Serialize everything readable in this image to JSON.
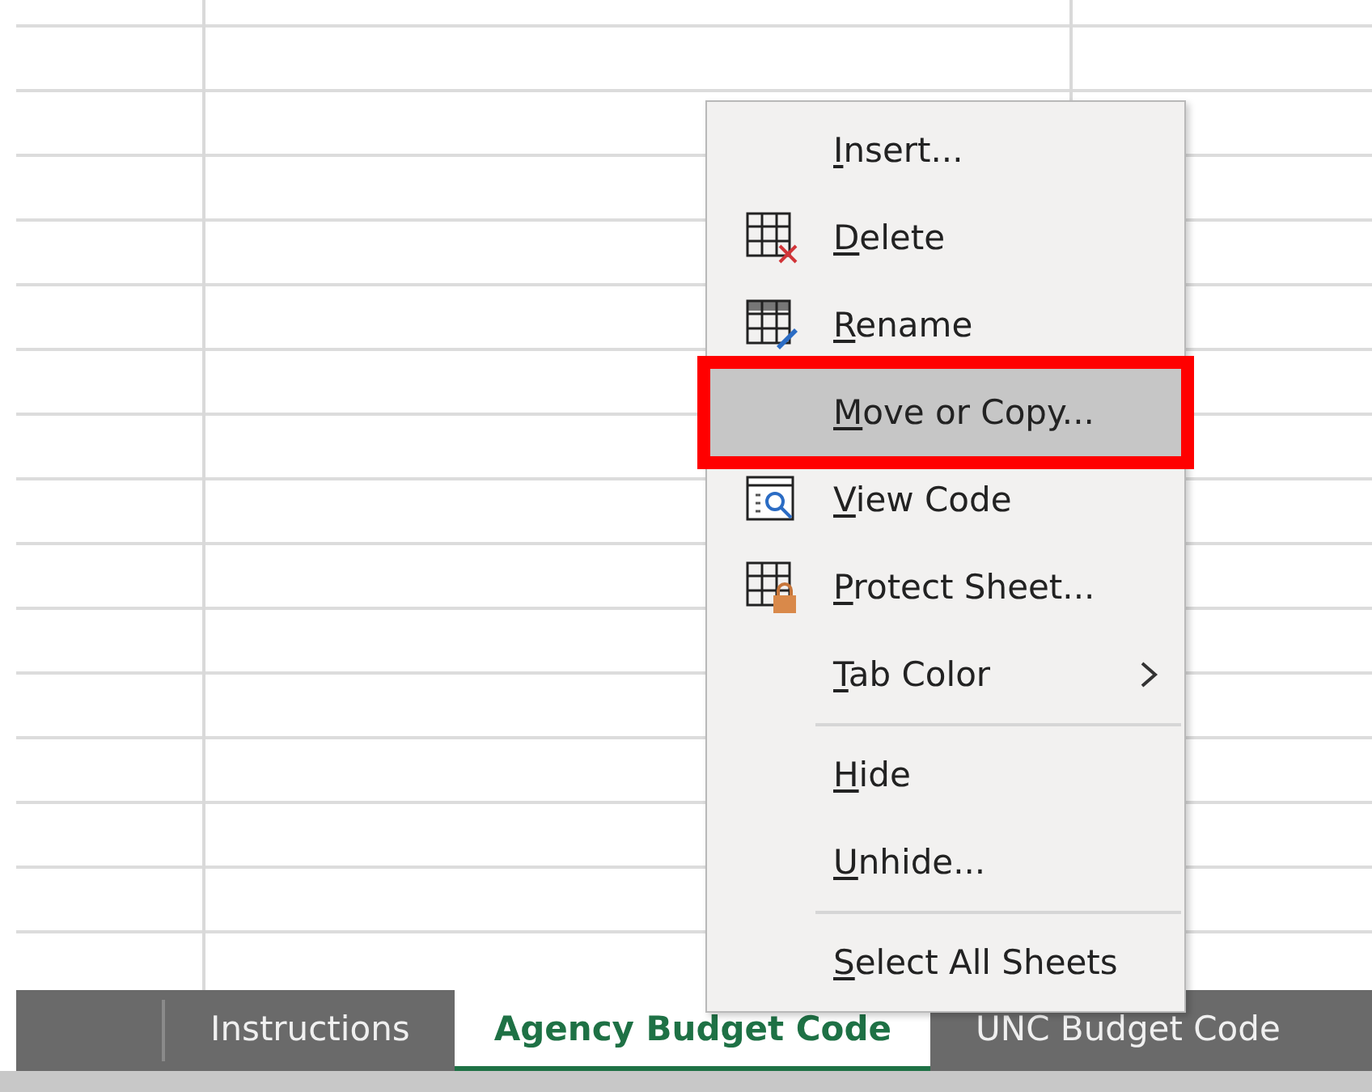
{
  "sheet_tabs": [
    {
      "label": "Instructions",
      "selected": false
    },
    {
      "label": "Agency Budget Code",
      "selected": true
    },
    {
      "label": "UNC Budget Code",
      "selected": false
    }
  ],
  "context_menu": {
    "items": [
      {
        "kind": "plain",
        "label": "Insert...",
        "selected": false
      },
      {
        "kind": "delete",
        "label": "Delete",
        "selected": false
      },
      {
        "kind": "rename",
        "label": "Rename",
        "selected": false
      },
      {
        "kind": "plain",
        "label": "Move or Copy...",
        "selected": true
      },
      {
        "kind": "code",
        "label": "View Code",
        "selected": false
      },
      {
        "kind": "protect",
        "label": "Protect Sheet...",
        "selected": false
      },
      {
        "kind": "submenu",
        "label": "Tab Color",
        "selected": false
      },
      {
        "kind": "separator"
      },
      {
        "kind": "plain",
        "label": "Hide",
        "selected": false
      },
      {
        "kind": "plain",
        "label": "Unhide...",
        "selected": false
      },
      {
        "kind": "separator"
      },
      {
        "kind": "plain",
        "label": "Select All Sheets",
        "selected": false
      }
    ]
  }
}
